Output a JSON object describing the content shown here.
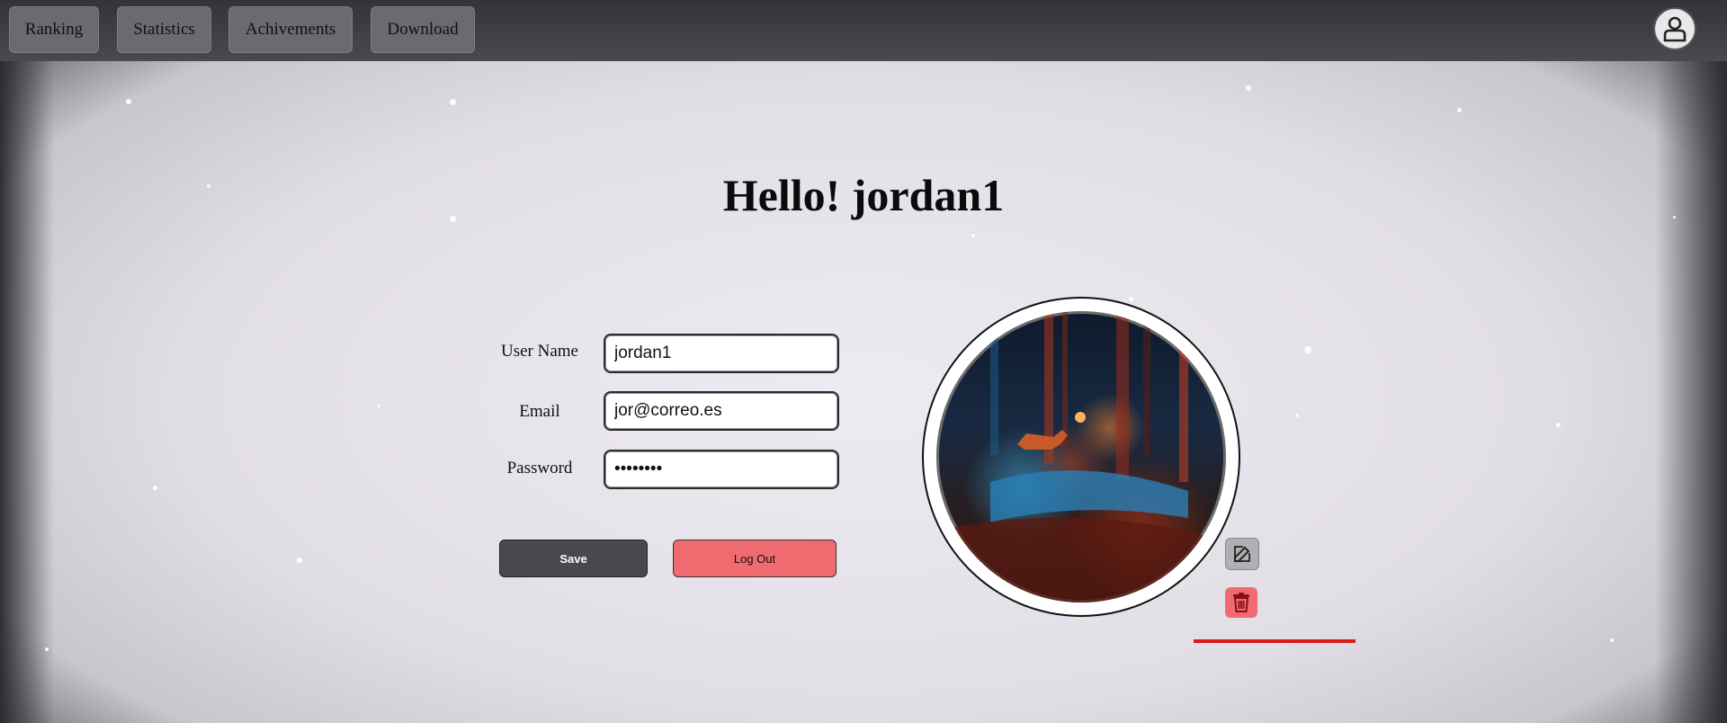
{
  "nav": {
    "items": [
      {
        "label": "Ranking"
      },
      {
        "label": "Statistics"
      },
      {
        "label": "Achivements"
      },
      {
        "label": "Download"
      }
    ],
    "user_icon": "user-icon"
  },
  "greeting": "Hello! jordan1",
  "form": {
    "username_label": "User Name",
    "username_value": "jordan1",
    "email_label": "Email",
    "email_value": "jor@correo.es",
    "password_label": "Password",
    "password_value": "••••••••",
    "save_label": "Save",
    "logout_label": "Log Out"
  },
  "avatar": {
    "edit_icon": "edit-icon",
    "delete_icon": "trash-icon"
  },
  "colors": {
    "save": "#49494d",
    "logout": "#ef6b70",
    "accent_line": "#d81c1c"
  }
}
